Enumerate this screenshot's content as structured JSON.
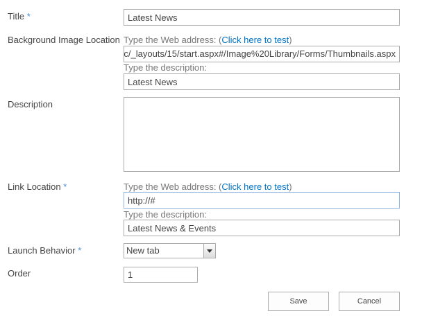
{
  "form": {
    "title": {
      "label": "Title",
      "required_mark": "*",
      "value": "Latest News"
    },
    "background_image": {
      "label": "Background Image Location",
      "address_hint": "Type the Web address: (",
      "test_link": "Click here to test",
      "hint_close": ")",
      "address_value": "c/_layouts/15/start.aspx#/Image%20Library/Forms/Thumbnails.aspx",
      "description_hint": "Type the description:",
      "description_value": "Latest News"
    },
    "description": {
      "label": "Description",
      "value": ""
    },
    "link_location": {
      "label": "Link Location",
      "required_mark": "*",
      "address_hint": "Type the Web address: (",
      "test_link": "Click here to test",
      "hint_close": ")",
      "address_value": "http://#",
      "description_hint": "Type the description:",
      "description_value": "Latest News & Events"
    },
    "launch_behavior": {
      "label": "Launch Behavior",
      "required_mark": "*",
      "selected": "New tab"
    },
    "order": {
      "label": "Order",
      "value": "1"
    }
  },
  "buttons": {
    "save": "Save",
    "cancel": "Cancel"
  },
  "colors": {
    "label_text": "#444444",
    "hint_text": "#777777",
    "link": "#0072c6",
    "required": "#4a8fd8",
    "border": "#ababab",
    "focus_border": "#8cb3e3"
  }
}
